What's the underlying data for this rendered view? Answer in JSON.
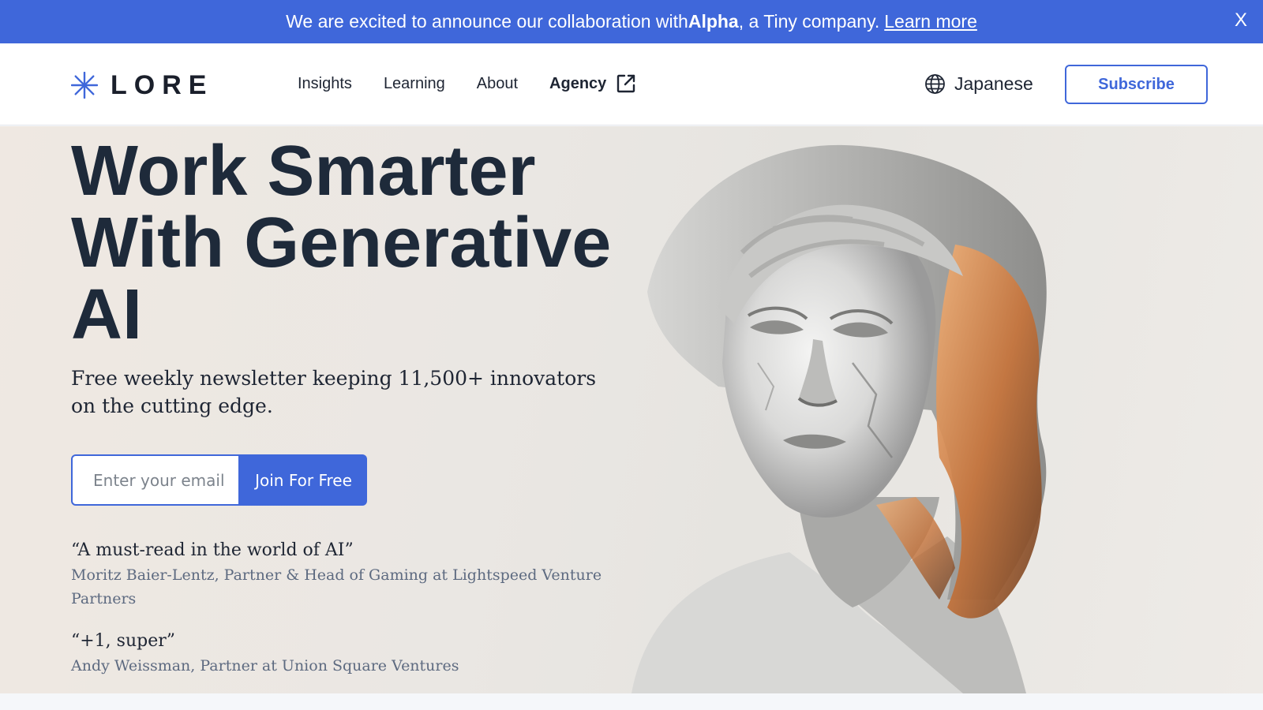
{
  "banner": {
    "text_before": "We are excited to announce our collaboration with ",
    "bold": "Alpha",
    "text_after": ", a Tiny company.",
    "link": "Learn more",
    "close": "X"
  },
  "header": {
    "logo_text": "LORE",
    "nav": [
      {
        "label": "Insights"
      },
      {
        "label": "Learning"
      },
      {
        "label": "About"
      },
      {
        "label": "Agency"
      }
    ],
    "language": "Japanese",
    "subscribe": "Subscribe"
  },
  "hero": {
    "headline_line1": "Work Smarter",
    "headline_line2": "With Generative",
    "headline_line3": "AI",
    "subhead": "Free weekly newsletter keeping 11,500+ innovators on the cutting edge.",
    "email_placeholder": "Enter your email",
    "join": "Join For Free",
    "quotes": [
      {
        "quote": "“A must-read in the world of AI”",
        "author": "Moritz Baier-Lentz, Partner & Head of Gaming at Lightspeed Venture Partners"
      },
      {
        "quote": "“+1, super”",
        "author": "Andy Weissman, Partner at Union Square Ventures"
      }
    ]
  },
  "colors": {
    "accent": "#3f67da",
    "heading": "#1e2a3a",
    "muted": "#5d6a80"
  },
  "icons": [
    "asterisk-logo-icon",
    "external-link-icon",
    "globe-icon",
    "close-icon"
  ]
}
